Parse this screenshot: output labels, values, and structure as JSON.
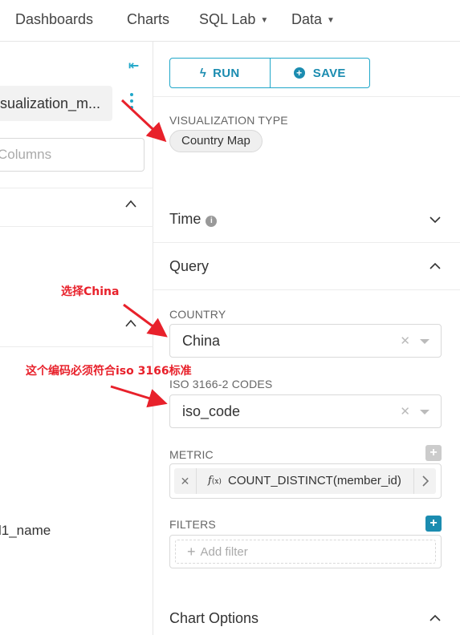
{
  "nav": {
    "items": [
      {
        "label": "Dashboards",
        "has_caret": false
      },
      {
        "label": "Charts",
        "has_caret": false
      },
      {
        "label": "SQL Lab",
        "has_caret": true
      },
      {
        "label": "Data",
        "has_caret": true
      }
    ]
  },
  "left": {
    "dataset_name": "isualization_m...",
    "search_placeholder": "Columns",
    "column_name": "l1_name"
  },
  "toolbar": {
    "run_label": "RUN",
    "save_label": "SAVE"
  },
  "viz": {
    "label": "VISUALIZATION TYPE",
    "value": "Country Map"
  },
  "sections": {
    "time": "Time",
    "query": "Query",
    "chart_options": "Chart Options"
  },
  "controls": {
    "country_label": "COUNTRY",
    "country_value": "China",
    "iso_label": "ISO 3166-2 CODES",
    "iso_value": "iso_code",
    "metric_label": "METRIC",
    "metric_value": "COUNT_DISTINCT(member_id)",
    "filters_label": "FILTERS",
    "add_filter": "Add filter"
  },
  "annotations": {
    "select_china": "选择China",
    "iso_note": "这个编码必须符合iso 3166标准"
  },
  "colors": {
    "accent": "#20a7c9",
    "annotation": "#e8212b",
    "metric_add": "#cccccc",
    "filter_add": "#1b8cb0"
  }
}
